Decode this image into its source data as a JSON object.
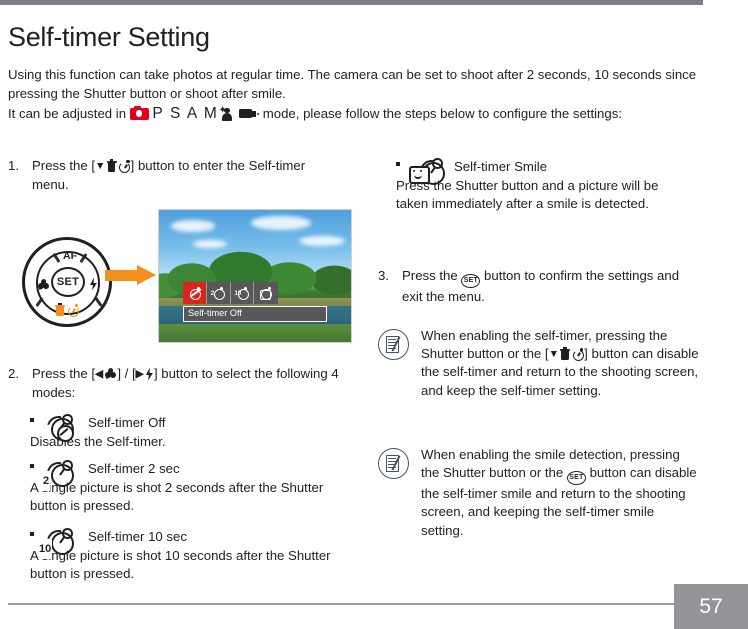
{
  "document": {
    "title": "Self-timer Setting",
    "page_number": "57"
  },
  "intro": {
    "paragraph1": "Using this function can take photos at regular time. The camera can be set to shoot after 2 seconds, 10 seconds since pressing the Shutter button or shoot after smile.",
    "mode_line_prefix": "It can be adjusted in ",
    "mode_icons": [
      "camera-icon",
      "P",
      "S",
      "A",
      "M",
      "portrait-plus-icon",
      "video-icon"
    ],
    "psam_letters": "P S A M",
    "mode_line_suffix": "mode, please follow the steps below to configure the settings:"
  },
  "steps": [
    {
      "number": "1.",
      "text_before_key": "Press the [",
      "key": "down-delete-timer",
      "text_after_key": "] button to enter the Self-timer menu."
    },
    {
      "number": "2.",
      "text_before_key": "Press the [",
      "key1": "left-macro",
      "separator": "] / [",
      "key2": "right-flash",
      "text_after_key": "] button to select the following 4 modes:"
    },
    {
      "number": "3.",
      "text_before_key": "Press the ",
      "key": "SET",
      "text_after_key": " button to confirm the settings and exit the menu."
    }
  ],
  "dial": {
    "center_label": "SET",
    "top_label": "AF",
    "left_icon": "macro-flower-icon",
    "right_icon": "flash-bolt-icon",
    "bottom_icons": "delete-timer-icon"
  },
  "lcd_preview": {
    "menu_items": [
      "self-timer-off-icon",
      "self-timer-2sec-icon",
      "self-timer-10sec-icon",
      "self-timer-smile-icon"
    ],
    "selected_index": 0,
    "status_label": "Self-timer Off",
    "numerals": [
      "",
      "2",
      "10",
      ""
    ]
  },
  "modes": [
    {
      "icon": "self-timer-off-icon",
      "numeral": "",
      "title": "Self-timer Off",
      "description": "Disables the Self-timer."
    },
    {
      "icon": "self-timer-2sec-icon",
      "numeral": "2",
      "title": "Self-timer 2 sec",
      "description": "A single picture is shot 2 seconds after the Shutter button is pressed."
    },
    {
      "icon": "self-timer-10sec-icon",
      "numeral": "10",
      "title": "Self-timer 10 sec",
      "description": "A single picture is shot 10 seconds after the Shutter button is pressed."
    },
    {
      "icon": "self-timer-smile-icon",
      "numeral": "",
      "title": "Self-timer Smile",
      "description": "Press the Shutter button and a picture will be taken immediately after a smile is detected."
    }
  ],
  "notes": [
    {
      "icon": "note-memo-icon",
      "part1": "When enabling the self-timer, pressing the Shutter button or the [",
      "inline_key": "down-delete-timer",
      "part2": "] button can disable the self-timer and return to the shooting screen, and keep the self-timer setting."
    },
    {
      "icon": "note-memo-icon",
      "part1": "When enabling the smile detection, pressing the Shutter button or the ",
      "inline_key": "SET",
      "part2": " button can disable the self-timer smile and return to the shooting screen, and keeping the self-timer smile setting."
    }
  ],
  "colors": {
    "accent_orange": "#f3901d",
    "accent_red": "#e3001b",
    "lcd_highlight": "#d9261c",
    "note_outline": "#44546a",
    "footer_gray": "#939598",
    "top_bar_gray": "#7d7f86"
  }
}
